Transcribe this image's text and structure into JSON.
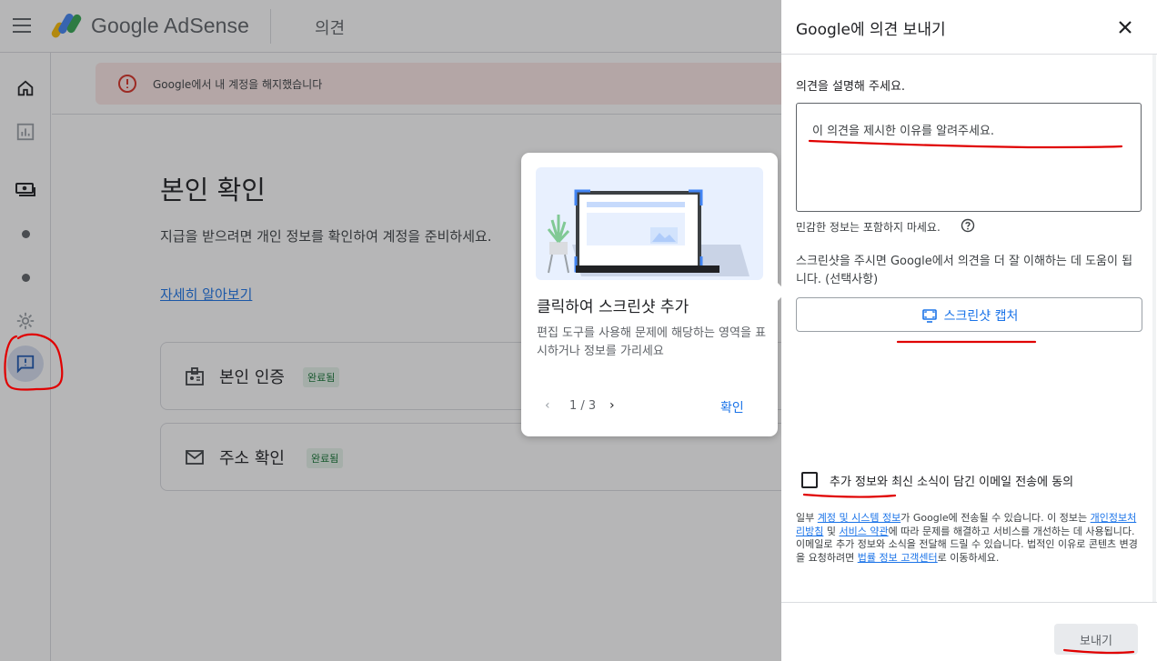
{
  "header": {
    "logo_text": "Google AdSense",
    "page_title": "의견"
  },
  "alert": {
    "text": "Google에서 내 계정을 해지했습니다"
  },
  "main": {
    "title": "본인 확인",
    "description": "지급을 받으려면 개인 정보를 확인하여 계정을 준비하세요.",
    "learn_more": "자세히 알아보기",
    "cards": [
      {
        "label": "본인 인증",
        "badge": "완료됨"
      },
      {
        "label": "주소 확인",
        "badge": "완료됨"
      }
    ]
  },
  "tour": {
    "title": "클릭하여 스크린샷 추가",
    "description": "편집 도구를 사용해 문제에 해당하는 영역을 표시하거나 정보를 가리세요",
    "counter": "1 / 3",
    "confirm": "확인"
  },
  "feedback_panel": {
    "title": "Google에 의견 보내기",
    "describe_label": "의견을 설명해 주세요.",
    "feedback_placeholder": "이 의견을 제시한 이유를 알려주세요.",
    "sensitive_note": "민감한 정보는 포함하지 마세요.",
    "screenshot_desc": "스크린샷을 주시면 Google에서 의견을 더 잘 이해하는 데 도움이 됩니다. (선택사항)",
    "capture_label": "스크린샷 캡처",
    "consent_label": "추가 정보와 최신 소식이 담긴 이메일 전송에 동의",
    "legal": {
      "p1": "일부 ",
      "link1": "계정 및 시스템 정보",
      "p2": "가 Google에 전송될 수 있습니다. 이 정보는 ",
      "link2": "개인정보처리방침",
      "p3": " 및 ",
      "link3": "서비스 약관",
      "p4": "에 따라 문제를 해결하고 서비스를 개선하는 데 사용됩니다. 이메일로 추가 정보와 소식을 전달해 드릴 수 있습니다. 법적인 이유로 콘텐츠 변경을 요청하려면 ",
      "link4": "법률 정보 고객센터",
      "p5": "로 이동하세요."
    },
    "send_label": "보내기"
  },
  "colors": {
    "accent": "#1a73e8",
    "alert_bg": "#fce8e6",
    "alert_icon": "#d93025",
    "badge_bg": "#e6f4ea",
    "badge_text": "#137333",
    "annotation": "#e00000"
  }
}
